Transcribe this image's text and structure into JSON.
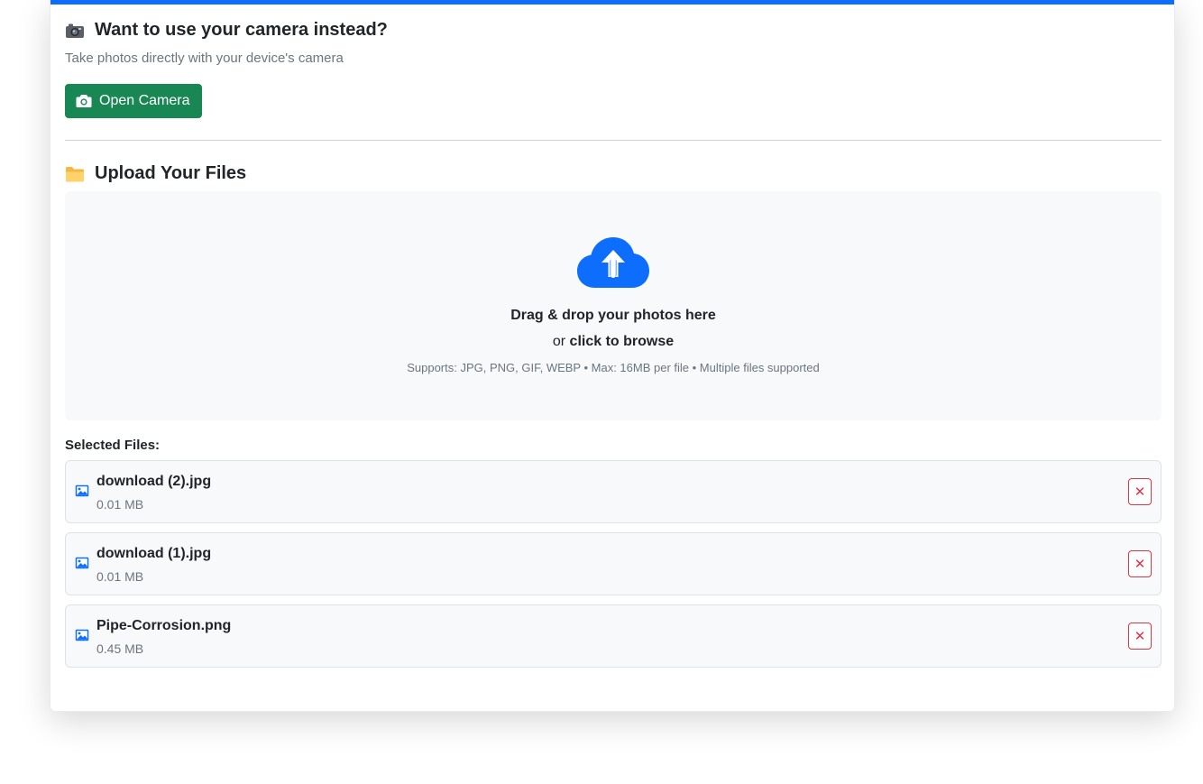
{
  "camera": {
    "title": "Want to use your camera instead?",
    "subtitle": "Take photos directly with your device's camera",
    "button_label": "Open Camera"
  },
  "upload": {
    "title": "Upload Your Files",
    "drop_text": "Drag & drop your photos here",
    "or_text": "or",
    "browse_text": "click to browse",
    "support_text": "Supports: JPG, PNG, GIF, WEBP • Max: 16MB per file • Multiple files supported"
  },
  "selected": {
    "label": "Selected Files:",
    "files": [
      {
        "name": "download (2).jpg",
        "size": "0.01 MB"
      },
      {
        "name": "download (1).jpg",
        "size": "0.01 MB"
      },
      {
        "name": "Pipe-Corrosion.png",
        "size": "0.45 MB"
      }
    ],
    "remove_symbol": "✕"
  },
  "colors": {
    "accent": "#0d6efd",
    "success": "#198754",
    "danger": "#dc3545"
  },
  "icons": {
    "camera_emoji": "camera-icon",
    "folder_emoji": "folder-icon",
    "upload": "cloud-upload-icon",
    "file": "image-file-icon",
    "remove": "close-icon"
  }
}
